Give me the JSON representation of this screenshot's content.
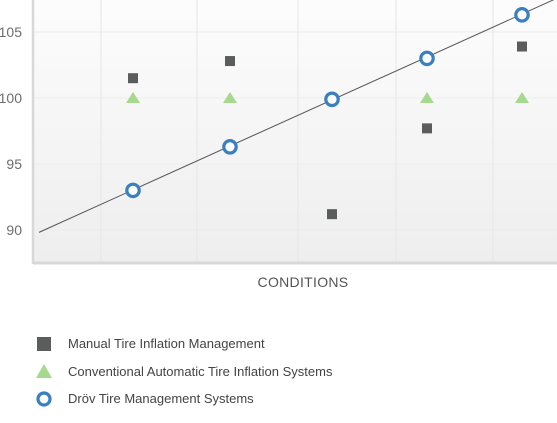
{
  "chart_data": {
    "type": "scatter",
    "xlabel": "CONDITIONS",
    "ylabel": "",
    "ylim": [
      87.5,
      107.5
    ],
    "y_ticks": [
      90,
      95,
      100,
      105
    ],
    "x": [
      1,
      2,
      3,
      4,
      5
    ],
    "grid": true,
    "legend_position": "bottom-left",
    "series": [
      {
        "name": "Manual Tire Inflation Management",
        "marker": "square",
        "color": "#5a5d5c",
        "values": [
          101.5,
          102.8,
          91.2,
          97.7,
          103.9
        ]
      },
      {
        "name": "Conventional Automatic Tire Inflation Systems",
        "marker": "triangle",
        "color": "#a6d98e",
        "values": [
          100.0,
          100.0,
          100.0,
          100.0,
          100.0
        ]
      },
      {
        "name": "Dröv Tire Management Systems",
        "marker": "circle-open",
        "color": "#3a80c0",
        "values": [
          93.0,
          96.3,
          99.9,
          103.0,
          106.3
        ]
      }
    ],
    "trendline": {
      "series": "Dröv Tire Management Systems",
      "color": "#555555"
    }
  }
}
